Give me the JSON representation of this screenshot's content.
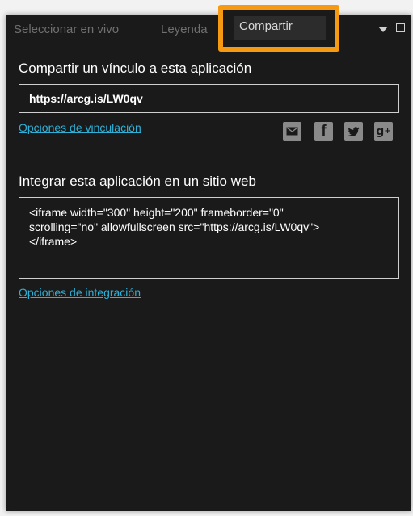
{
  "tabs": {
    "live": "Seleccionar en vivo",
    "legend": "Leyenda",
    "share": "Compartir"
  },
  "highlight_color": "#f59a11",
  "share_link": {
    "title": "Compartir un vínculo a esta aplicación",
    "url": "https://arcg.is/LW0qv",
    "options_link": "Opciones de vinculación",
    "social": [
      {
        "name": "email-icon",
        "glyph": "✉"
      },
      {
        "name": "facebook-icon",
        "glyph": "f"
      },
      {
        "name": "twitter-icon",
        "glyph": "t"
      },
      {
        "name": "google-plus-icon",
        "glyph": "g+"
      }
    ]
  },
  "embed": {
    "title": "Integrar esta aplicación en un sitio web",
    "code": "<iframe width=\"300\" height=\"200\" frameborder=\"0\"\nscrolling=\"no\" allowfullscreen src=\"https://arcg.is/LW0qv\">\n</iframe>",
    "options_link": "Opciones de integración"
  }
}
